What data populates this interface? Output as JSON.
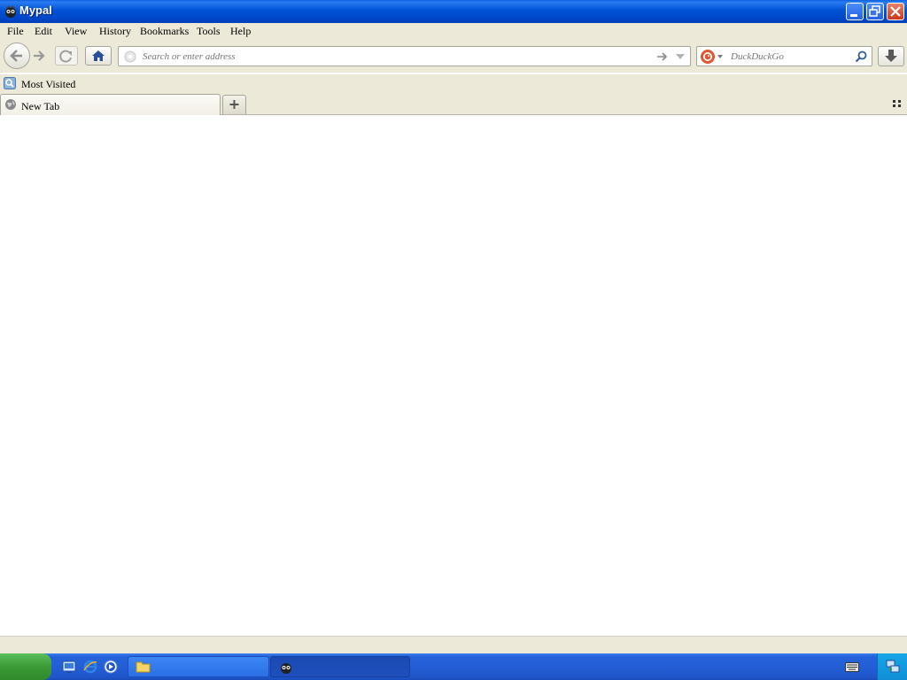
{
  "window": {
    "title": "Mypal"
  },
  "menu": {
    "items": [
      {
        "label": "File"
      },
      {
        "label": "Edit"
      },
      {
        "label": "View"
      },
      {
        "label": "History"
      },
      {
        "label": "Bookmarks"
      },
      {
        "label": "Tools"
      },
      {
        "label": "Help"
      }
    ]
  },
  "navbar": {
    "url_placeholder": "Search or enter address",
    "url_value": "",
    "search_placeholder": "DuckDuckGo",
    "search_engine_icon": "duckduckgo-icon"
  },
  "bookmarks": {
    "items": [
      {
        "label": "Most Visited",
        "icon": "most-visited-icon"
      }
    ]
  },
  "tabs": {
    "items": [
      {
        "label": "New Tab",
        "active": true,
        "icon": "globe-icon"
      }
    ]
  },
  "taskbar": {
    "quick_launch": [
      "desktop-icon",
      "internet-explorer-icon",
      "media-player-icon"
    ],
    "tasks": [
      {
        "icon": "folder-icon",
        "label": ""
      },
      {
        "icon": "mypal-icon",
        "label": ""
      }
    ]
  },
  "colors": {
    "chrome_bg": "#ece9d8",
    "titlebar": "#0052d6",
    "taskbar": "#245ed6",
    "start_green": "#3b9a36"
  }
}
